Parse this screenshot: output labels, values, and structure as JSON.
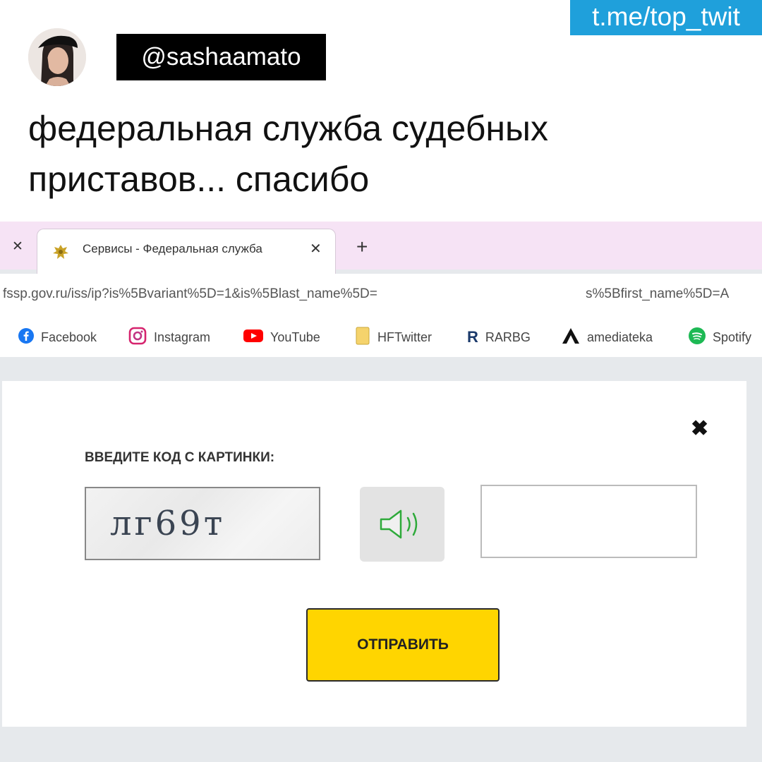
{
  "watermark": "t.me/top_twit",
  "tweet": {
    "handle": "@sashaamato",
    "text_line1": "федеральная служба судебных",
    "text_line2": "приставов... спасибо"
  },
  "browser": {
    "tab_title": "Сервисы - Федеральная служба",
    "url_left": "fssp.gov.ru/iss/ip?is%5Bvariant%5D=1&is%5Blast_name%5D=",
    "url_right": "s%5Bfirst_name%5D=A",
    "bookmarks": [
      {
        "label": "Facebook",
        "icon": "facebook-icon"
      },
      {
        "label": "Instagram",
        "icon": "instagram-icon"
      },
      {
        "label": "YouTube",
        "icon": "youtube-icon"
      },
      {
        "label": "HFTwitter",
        "icon": "folder-icon"
      },
      {
        "label": "RARBG",
        "icon": "rarbg-icon"
      },
      {
        "label": "amediateka",
        "icon": "amediateka-icon"
      },
      {
        "label": "Spotify",
        "icon": "spotify-icon"
      }
    ]
  },
  "modal": {
    "captcha_label": "ВВЕДИТЕ КОД С КАРТИНКИ:",
    "captcha_text": "лг69т",
    "input_value": "",
    "submit_label": "ОТПРАВИТЬ"
  },
  "colors": {
    "watermark_bg": "#1fa0db",
    "tabstrip_bg": "#f6e3f5",
    "submit_bg": "#ffd500",
    "audio_icon": "#2eaa3a"
  }
}
